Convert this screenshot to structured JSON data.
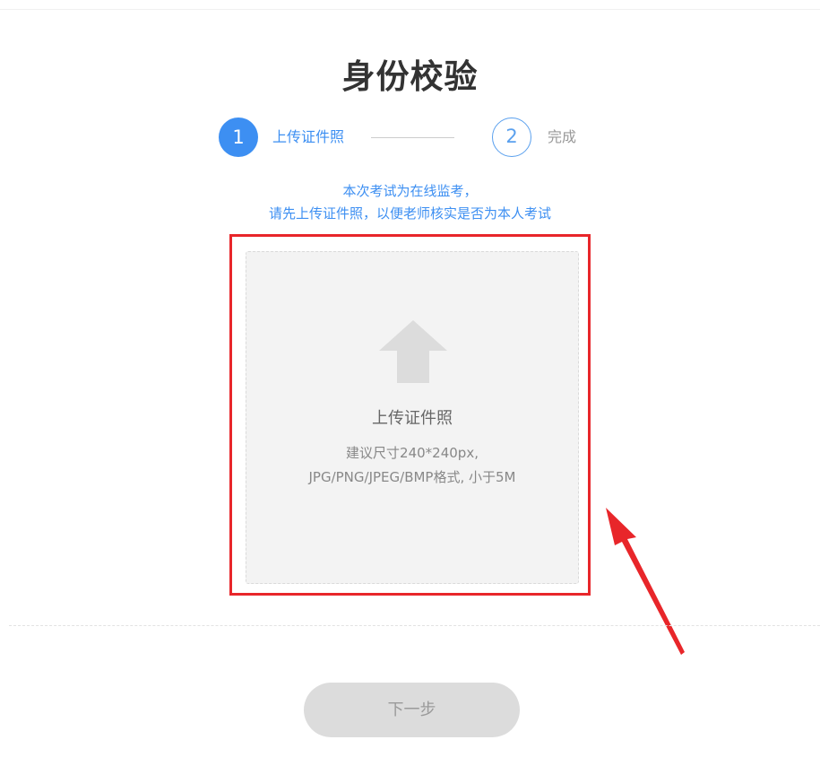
{
  "page": {
    "title": "身份校验"
  },
  "steps": [
    {
      "number": "1",
      "label": "上传证件照",
      "state": "active"
    },
    {
      "number": "2",
      "label": "完成",
      "state": "pending"
    }
  ],
  "notice": {
    "line1": "本次考试为在线监考，",
    "line2": "请先上传证件照，以便老师核实是否为本人考试"
  },
  "upload": {
    "icon": "upload-arrow-icon",
    "title": "上传证件照",
    "hint_line1": "建议尺寸240*240px,",
    "hint_line2": "JPG/PNG/JPEG/BMP格式, 小于5M"
  },
  "annotation": {
    "highlight_color": "#e8262a"
  },
  "next_button": {
    "label": "下一步",
    "enabled": false
  },
  "colors": {
    "accent": "#3d8ff2",
    "disabled_button": "#dcdcdc"
  }
}
